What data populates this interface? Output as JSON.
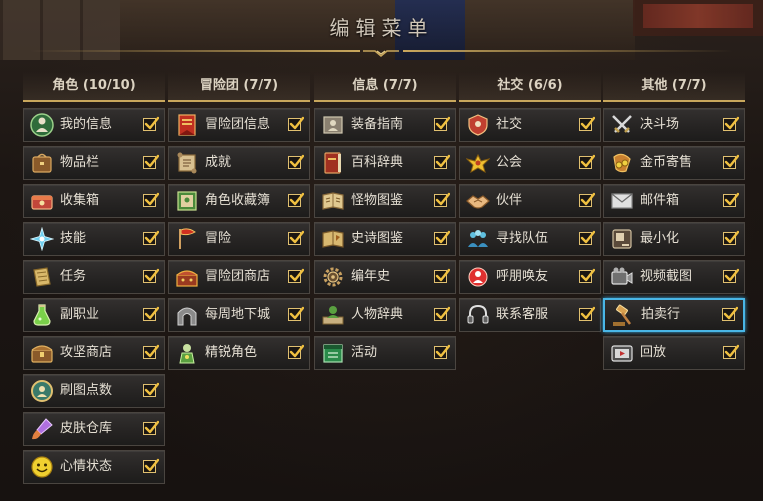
{
  "title": "编辑菜单",
  "colors": {
    "gold": "#c9a75c",
    "check": "#f0c040",
    "selected": "#49b6e6"
  },
  "columns": [
    {
      "header": "角色 (10/10)",
      "items": [
        {
          "label": "我的信息",
          "icon": "character-icon",
          "checked": true
        },
        {
          "label": "物品栏",
          "icon": "inventory-bag-icon",
          "checked": true
        },
        {
          "label": "收集箱",
          "icon": "collection-box-icon",
          "checked": true
        },
        {
          "label": "技能",
          "icon": "skill-star-icon",
          "checked": true
        },
        {
          "label": "任务",
          "icon": "quest-scroll-icon",
          "checked": true
        },
        {
          "label": "副职业",
          "icon": "potion-icon",
          "checked": true
        },
        {
          "label": "攻坚商店",
          "icon": "treasure-chest-icon",
          "checked": true
        },
        {
          "label": "刷图点数",
          "icon": "points-medal-icon",
          "checked": true
        },
        {
          "label": "皮肤仓库",
          "icon": "paint-brush-icon",
          "checked": true
        },
        {
          "label": "心情状态",
          "icon": "smiley-icon",
          "checked": true
        }
      ]
    },
    {
      "header": "冒险团 (7/7)",
      "items": [
        {
          "label": "冒险团信息",
          "icon": "guild-banner-icon",
          "checked": true
        },
        {
          "label": "成就",
          "icon": "achievement-scroll-icon",
          "checked": true
        },
        {
          "label": "角色收藏簿",
          "icon": "card-book-icon",
          "checked": true
        },
        {
          "label": "冒险",
          "icon": "adventure-flag-icon",
          "checked": true
        },
        {
          "label": "冒险团商店",
          "icon": "shop-chest-icon",
          "checked": true
        },
        {
          "label": "每周地下城",
          "icon": "dungeon-gate-icon",
          "checked": true
        },
        {
          "label": "精锐角色",
          "icon": "elite-character-icon",
          "checked": true
        }
      ]
    },
    {
      "header": "信息 (7/7)",
      "items": [
        {
          "label": "装备指南",
          "icon": "equipment-guide-icon",
          "checked": true
        },
        {
          "label": "百科辞典",
          "icon": "encyclopedia-book-icon",
          "checked": true
        },
        {
          "label": "怪物图鉴",
          "icon": "monster-book-icon",
          "checked": true
        },
        {
          "label": "史诗图鉴",
          "icon": "epic-book-icon",
          "checked": true
        },
        {
          "label": "编年史",
          "icon": "chronicle-gear-icon",
          "checked": true
        },
        {
          "label": "人物辞典",
          "icon": "character-dictionary-icon",
          "checked": true
        },
        {
          "label": "活动",
          "icon": "event-calendar-icon",
          "checked": true
        }
      ]
    },
    {
      "header": "社交 (6/6)",
      "items": [
        {
          "label": "社交",
          "icon": "social-shield-icon",
          "checked": true
        },
        {
          "label": "公会",
          "icon": "guild-eagle-icon",
          "checked": true
        },
        {
          "label": "伙伴",
          "icon": "handshake-icon",
          "checked": true
        },
        {
          "label": "寻找队伍",
          "icon": "party-search-icon",
          "checked": true
        },
        {
          "label": "呼朋唤友",
          "icon": "call-friends-icon",
          "checked": true
        },
        {
          "label": "联系客服",
          "icon": "headset-icon",
          "checked": true
        }
      ]
    },
    {
      "header": "其他 (7/7)",
      "items": [
        {
          "label": "决斗场",
          "icon": "crossed-swords-icon",
          "checked": true
        },
        {
          "label": "金币寄售",
          "icon": "gold-coins-icon",
          "checked": true
        },
        {
          "label": "邮件箱",
          "icon": "mail-envelope-icon",
          "checked": true
        },
        {
          "label": "最小化",
          "icon": "minimize-icon",
          "checked": true
        },
        {
          "label": "视频截图",
          "icon": "video-camera-icon",
          "checked": true
        },
        {
          "label": "拍卖行",
          "icon": "auction-gavel-icon",
          "checked": true,
          "selected": true
        },
        {
          "label": "回放",
          "icon": "replay-tv-icon",
          "checked": true
        }
      ]
    }
  ]
}
